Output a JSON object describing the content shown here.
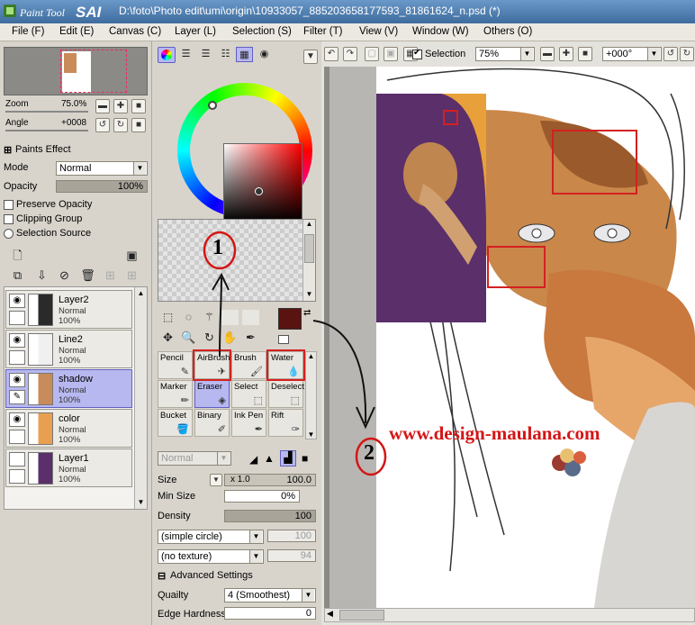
{
  "app": {
    "name": "PaintTool SAI",
    "title": "D:\\foto\\Photo edit\\umi\\origin\\10933057_885203658177593_81861624_n.psd (*)"
  },
  "menu": [
    "File (F)",
    "Edit (E)",
    "Canvas (C)",
    "Layer (L)",
    "Selection (S)",
    "Filter (T)",
    "View (V)",
    "Window (W)",
    "Others (O)"
  ],
  "navigator": {
    "zoom_label": "Zoom",
    "zoom_value": "75.0%",
    "angle_label": "Angle",
    "angle_value": "+0008"
  },
  "layer_props": {
    "section_label": "Paints Effect",
    "mode_label": "Mode",
    "mode_value": "Normal",
    "opacity_label": "Opacity",
    "opacity_value": "100%",
    "opacity_fraction": 1.0,
    "checks": [
      "Preserve Opacity",
      "Clipping Group",
      "Selection Source"
    ]
  },
  "layers": [
    {
      "name": "Layer2",
      "mode": "Normal",
      "opacity": "100%",
      "visible": true,
      "selected": false
    },
    {
      "name": "Line2",
      "mode": "Normal",
      "opacity": "100%",
      "visible": true,
      "selected": false
    },
    {
      "name": "shadow",
      "mode": "Normal",
      "opacity": "100%",
      "visible": true,
      "selected": true
    },
    {
      "name": "color",
      "mode": "Normal",
      "opacity": "100%",
      "visible": true,
      "selected": false
    },
    {
      "name": "Layer1",
      "mode": "Normal",
      "opacity": "100%",
      "visible": false,
      "selected": false
    }
  ],
  "colors": {
    "primary": "#5a1410",
    "secondary": "#ffffff",
    "selection_red": "#d42020",
    "highlight": "#b8b8f0"
  },
  "tools": [
    {
      "name": "Pencil",
      "selected": false
    },
    {
      "name": "AirBrush",
      "selected": false
    },
    {
      "name": "Brush",
      "selected": false
    },
    {
      "name": "Water",
      "selected": false
    },
    {
      "name": "Marker",
      "selected": false
    },
    {
      "name": "Eraser",
      "selected": true
    },
    {
      "name": "Select",
      "selected": false
    },
    {
      "name": "Deselect",
      "selected": false
    },
    {
      "name": "Bucket",
      "selected": false
    },
    {
      "name": "Binary",
      "selected": false
    },
    {
      "name": "Ink Pen",
      "selected": false
    },
    {
      "name": "Rift",
      "selected": false
    }
  ],
  "brush": {
    "blend_mode": "Normal",
    "size_label": "Size",
    "size_mult": "x 1.0",
    "size_value": "100.0",
    "min_size_label": "Min Size",
    "min_size_value": "0%",
    "density_label": "Density",
    "density_value": "100",
    "density_fraction": 1.0,
    "shape": "(simple circle)",
    "shape_value": "100",
    "texture": "(no texture)",
    "texture_value": "94",
    "advanced_label": "Advanced Settings",
    "quality_label": "Quailty",
    "quality_value": "4 (Smoothest)",
    "edge_label": "Edge Hardness",
    "edge_value": "0"
  },
  "canvas_toolbar": {
    "selection_label": "Selection",
    "zoom": "75%",
    "angle": "+000°"
  },
  "annotations": {
    "num1": "1",
    "num2": "2",
    "watermark": "www.design-maulana.com"
  }
}
